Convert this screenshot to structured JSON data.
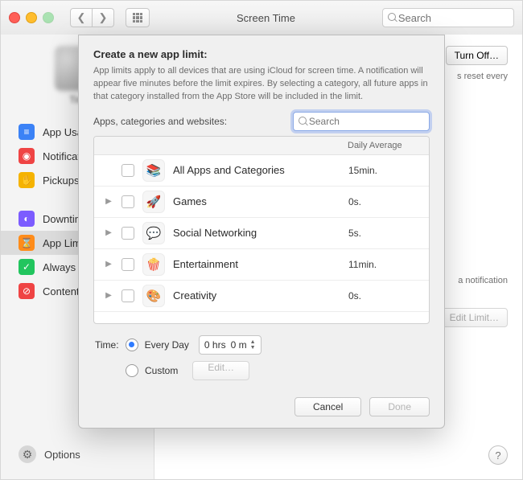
{
  "window": {
    "title": "Screen Time",
    "search_placeholder": "Search"
  },
  "sidebar": {
    "user_label": "Tim",
    "items": [
      {
        "label": "App Usage",
        "color": "#3b82f6",
        "glyph": "≡"
      },
      {
        "label": "Notifications",
        "color": "#ef4444",
        "glyph": "◉"
      },
      {
        "label": "Pickups",
        "color": "#f5b301",
        "glyph": "✋"
      }
    ],
    "items2": [
      {
        "label": "Downtime",
        "color": "#7c5cff",
        "glyph": "◐"
      },
      {
        "label": "App Limits",
        "color": "#ff8c1a",
        "glyph": "⌛",
        "selected": true
      },
      {
        "label": "Always Allowed",
        "color": "#22c55e",
        "glyph": "✓"
      },
      {
        "label": "Content",
        "color": "#ef4444",
        "glyph": "⊘"
      }
    ],
    "options_label": "Options"
  },
  "background_panel": {
    "turn_off_label": "Turn Off…",
    "reset_text": "s reset every",
    "notif_text": "a notification",
    "edit_limit_label": "Edit Limit…",
    "help_glyph": "?"
  },
  "modal": {
    "heading": "Create a new app limit:",
    "description": "App limits apply to all devices that are using iCloud for screen time. A notification will appear five minutes before the limit expires. By selecting a category, all future apps in that category installed from the App Store will be included in the limit.",
    "list_label": "Apps, categories and websites:",
    "search_placeholder": "Search",
    "column_header": "Daily Average",
    "categories": [
      {
        "label": "All Apps and Categories",
        "avg": "15min.",
        "glyph": "📚",
        "expandable": false
      },
      {
        "label": "Games",
        "avg": "0s.",
        "glyph": "🚀",
        "expandable": true
      },
      {
        "label": "Social Networking",
        "avg": "5s.",
        "glyph": "💬",
        "expandable": true
      },
      {
        "label": "Entertainment",
        "avg": "11min.",
        "glyph": "🍿",
        "expandable": true
      },
      {
        "label": "Creativity",
        "avg": "0s.",
        "glyph": "🎨",
        "expandable": true
      }
    ],
    "time_label": "Time:",
    "every_day_label": "Every Day",
    "hours_value": "0 hrs",
    "minutes_value": "0 m",
    "custom_label": "Custom",
    "edit_button": "Edit…",
    "cancel_label": "Cancel",
    "done_label": "Done"
  }
}
